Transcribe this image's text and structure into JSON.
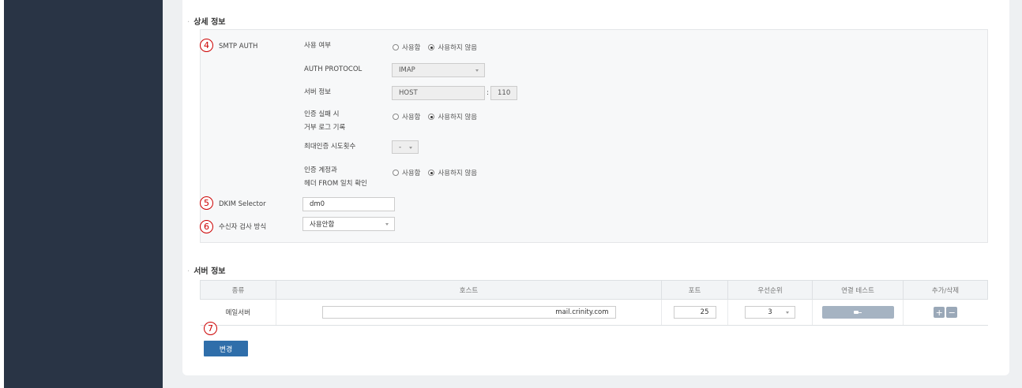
{
  "sections": {
    "detail_title": "상세 정보",
    "server_title": "서버 정보"
  },
  "markers": [
    "4",
    "5",
    "6",
    "7"
  ],
  "smtp_auth": {
    "label": "SMTP AUTH",
    "use_label": "사용 여부",
    "use_options": [
      "사용함",
      "사용하지 않음"
    ],
    "use_selected": "사용하지 않음",
    "protocol_label": "AUTH PROTOCOL",
    "protocol_value": "IMAP",
    "server_label": "서버 정보",
    "host_value": "HOST",
    "port_sep": ":",
    "port_value": "110",
    "fail_log_label_1": "인증 실패 시",
    "fail_log_label_2": "거부 로그 기록",
    "fail_log_options": [
      "사용함",
      "사용하지 않음"
    ],
    "fail_log_selected": "사용하지 않음",
    "max_attempts_label": "최대인증 시도횟수",
    "max_attempts_value": "-",
    "match_label_1": "인증 계정과",
    "match_label_2": "헤더 FROM 일치 확인",
    "match_options": [
      "사용함",
      "사용하지 않음"
    ],
    "match_selected": "사용하지 않음"
  },
  "dkim": {
    "label": "DKIM Selector",
    "value": "dm0"
  },
  "recipient_check": {
    "label": "수신자 검사 방식",
    "value": "사용안함"
  },
  "server_table": {
    "headers": [
      "종류",
      "호스트",
      "포트",
      "우선순위",
      "연결 테스트",
      "추가/삭제"
    ],
    "rows": [
      {
        "type": "메일서버",
        "host": "mail.crinity.com",
        "port": "25",
        "priority": "3"
      }
    ],
    "add_symbol": "+",
    "remove_symbol": "−"
  },
  "submit_label": "변경",
  "colors": {
    "sidebar": "#293445",
    "primary_button": "#2f6eaa",
    "marker": "#cc0000"
  }
}
